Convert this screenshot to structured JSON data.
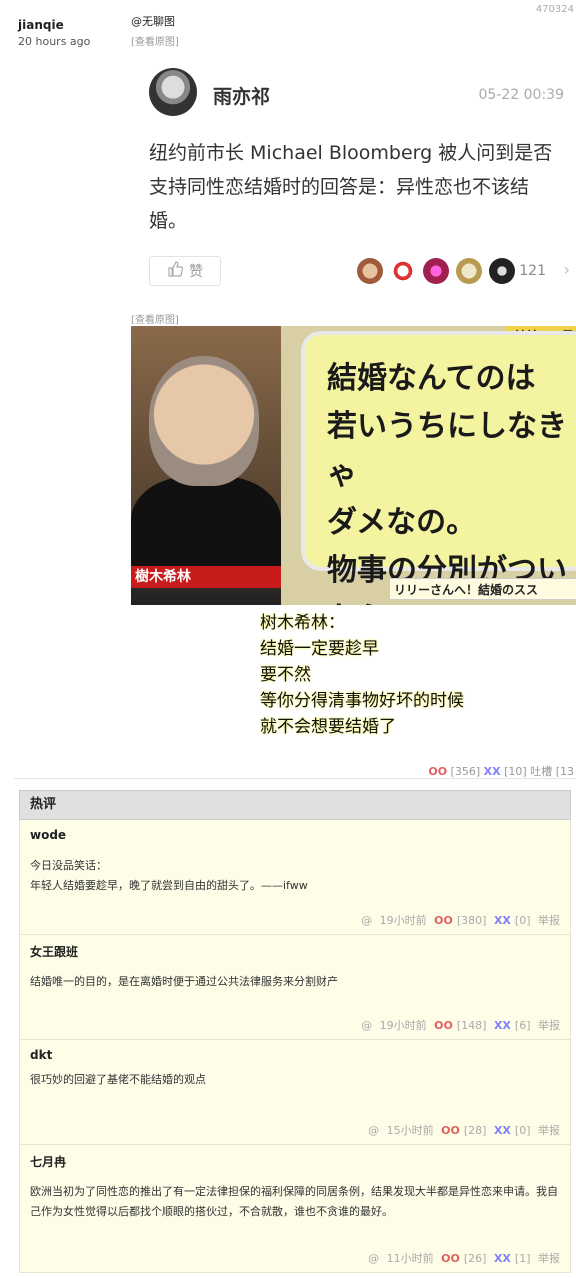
{
  "post": {
    "id_fragment": "470324",
    "author": "jianqie",
    "time_ago": "20 hours ago",
    "tag": "@无聊图",
    "view_original": "[查看原图]",
    "actions": {
      "oo_label": "OO",
      "oo_count": "[356]",
      "xx_label": "XX",
      "xx_count": "[10]",
      "tucao": "吐槽 [13"
    }
  },
  "weibo": {
    "name": "雨亦祁",
    "date": "05-22 00:39",
    "text": "纽约前市长 Michael Bloomberg 被人问到是否支持同性恋结婚时的回答是：异性恋也不该结婚。",
    "like_label": "赞",
    "like_count": "121"
  },
  "photo": {
    "name_strip": "樹木希林",
    "bubble_text": "結婚なんてのは\n若いうちにしなきゃ\nダメなの。\n物事の分別がついたら\nできないんだから",
    "top_right": "リリー・フラ",
    "bottom_bar": "リリーさんへ！結婚のスス"
  },
  "caption": "树木希林：\n结婚一定要趁早\n要不然\n等你分得清事物好坏的时候\n就不会想要结婚了",
  "hot": {
    "header": "热评",
    "comments": [
      {
        "author": "wode",
        "text": "今日没品笑话：\n年轻人结婚要趁早，晚了就尝到自由的甜头了。——ifww",
        "time": "19小时前",
        "oo": "OO",
        "oo_count": "[380]",
        "xx": "XX",
        "xx_count": "[0]",
        "report": "举报",
        "at": "@"
      },
      {
        "author": "女王跟班",
        "text": "结婚唯一的目的，是在离婚时便于通过公共法律服务来分割财产",
        "time": "19小时前",
        "oo": "OO",
        "oo_count": "[148]",
        "xx": "XX",
        "xx_count": "[6]",
        "report": "举报",
        "at": "@"
      },
      {
        "author": "dkt",
        "text": "很巧妙的回避了基佬不能结婚的观点",
        "time": "15小时前",
        "oo": "OO",
        "oo_count": "[28]",
        "xx": "XX",
        "xx_count": "[0]",
        "report": "举报",
        "at": "@"
      },
      {
        "author": "七月冉",
        "text": "欧洲当初为了同性恋的推出了有一定法律担保的福利保障的同居条例，结果发现大半都是异性恋来申请。我自己作为女性觉得以后都找个顺眼的搭伙过，不合就散，谁也不贪谁的最好。",
        "time": "11小时前",
        "oo": "OO",
        "oo_count": "[26]",
        "xx": "XX",
        "xx_count": "[1]",
        "report": "举报",
        "at": "@"
      }
    ]
  },
  "colors": {
    "oo": "#e06060",
    "xx": "#8080ff",
    "comment_bg": "#fdfde8",
    "header_bg": "#e0e0e0"
  }
}
